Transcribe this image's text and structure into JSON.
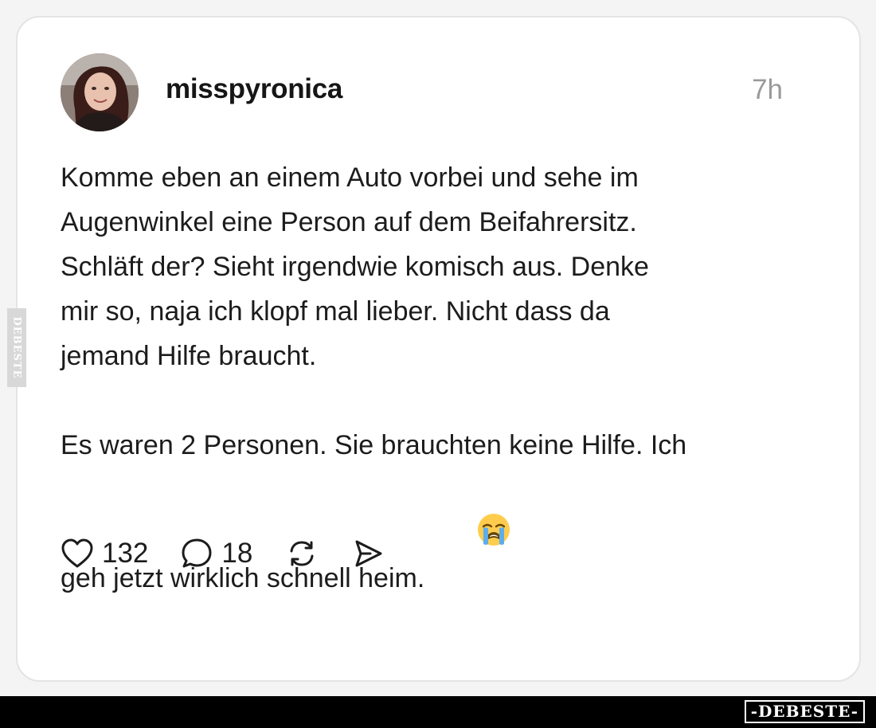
{
  "post": {
    "username": "misspyronica",
    "time": "7h",
    "paragraphs": [
      "Komme eben an einem Auto vorbei und sehe im\nAugenwinkel eine Person auf dem Beifahrersitz.\nSchläft der? Sieht irgendwie komisch aus. Denke\nmir so, naja ich klopf mal lieber. Nicht dass da\njemand Hilfe braucht.",
      "Es waren 2 Personen. Sie brauchten keine Hilfe. Ich\ngeh jetzt wirklich schnell heim."
    ],
    "emoji": "loudly-crying-face-emoji",
    "avatar_icon": "profile-photo"
  },
  "actions": {
    "like": {
      "icon": "heart-icon",
      "count": "132"
    },
    "comment": {
      "icon": "comment-bubble-icon",
      "count": "18"
    },
    "repost": {
      "icon": "repost-icon"
    },
    "share": {
      "icon": "send-icon"
    }
  },
  "watermark": {
    "side_text": "DEBESTE",
    "logo_text": "-DEBESTE-"
  },
  "colors": {
    "text": "#1c1c1c",
    "muted": "#9a9a9a",
    "card_border": "#e4e4e4",
    "bar": "#000000"
  }
}
